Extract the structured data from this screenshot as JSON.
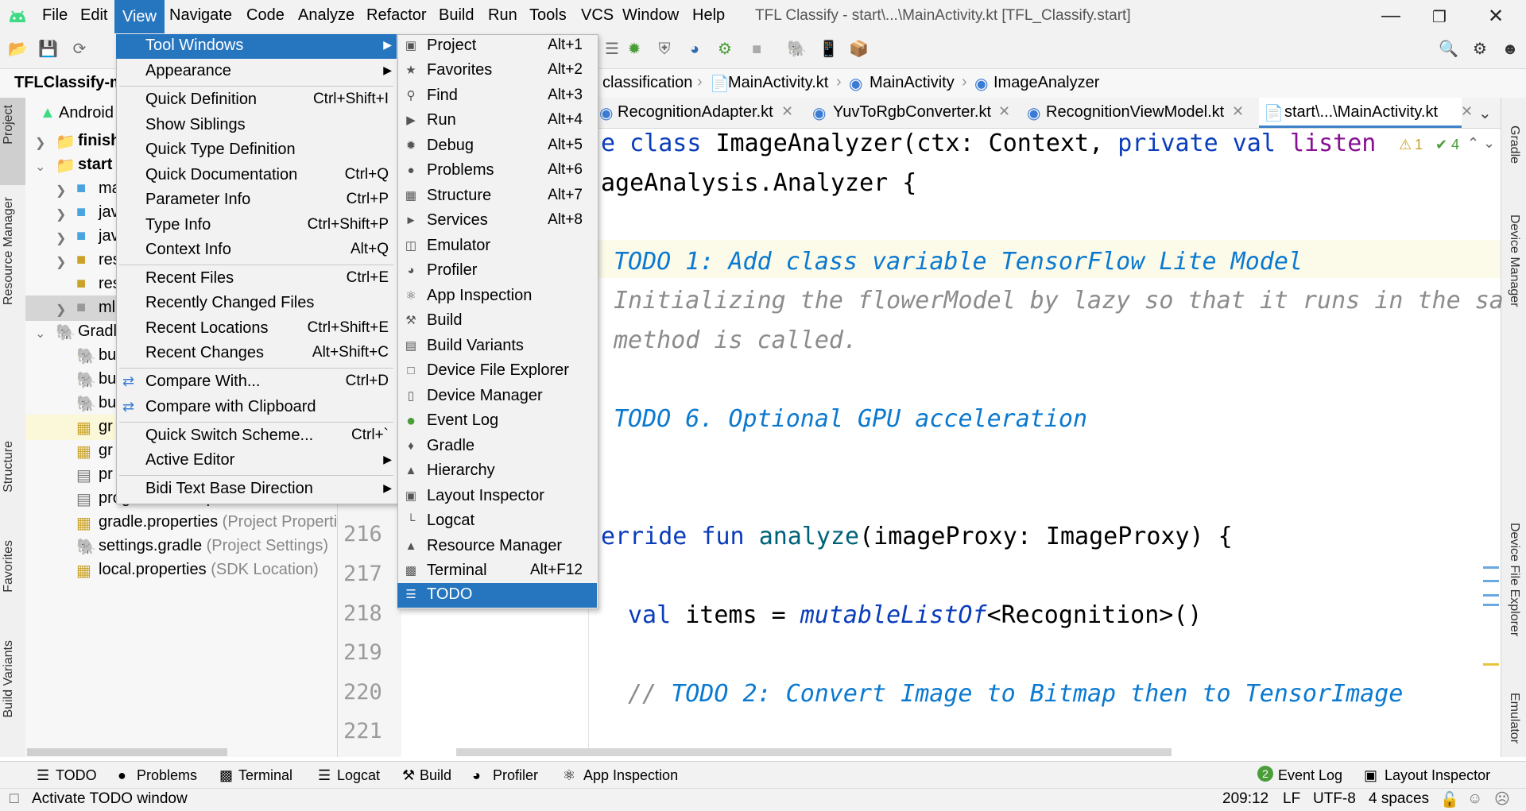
{
  "app": {
    "window_title": "TFL Classify - start\\...\\MainActivity.kt [TFL_Classify.start]"
  },
  "menubar": [
    "File",
    "Edit",
    "View",
    "Navigate",
    "Code",
    "Analyze",
    "Refactor",
    "Build",
    "Run",
    "Tools",
    "VCS",
    "Window",
    "Help"
  ],
  "navbar": {
    "project": "TFLClassify-ma",
    "crumbs": [
      "classification",
      "MainActivity.kt",
      "MainActivity",
      "ImageAnalyzer"
    ]
  },
  "editor_tabs": [
    "RecognitionAdapter.kt",
    "YuvToRgbConverter.kt",
    "RecognitionViewModel.kt",
    "start\\...\\MainActivity.kt"
  ],
  "inspection": {
    "warnings": "1",
    "checks": "4"
  },
  "project_tree": {
    "root": "Android",
    "items": [
      {
        "text": "finish",
        "bold": true
      },
      {
        "text": "start",
        "bold": true
      },
      {
        "text": "ma"
      },
      {
        "text": "jav"
      },
      {
        "text": "jav"
      },
      {
        "text": "res"
      },
      {
        "text": "res"
      },
      {
        "text": "ml"
      },
      {
        "text": "Gradl"
      },
      {
        "text": "bu"
      },
      {
        "text": "bu"
      },
      {
        "text": "bu"
      },
      {
        "text": "gr"
      },
      {
        "text": "gr"
      },
      {
        "text": "pr"
      },
      {
        "text": "proguard-rules.pro"
      },
      {
        "text": "gradle.properties",
        "hint": "(Project Properti"
      },
      {
        "text": "settings.gradle",
        "hint": "(Project Settings)"
      },
      {
        "text": "local.properties",
        "hint": "(SDK Location)"
      }
    ]
  },
  "line_numbers": [
    "216",
    "217",
    "218",
    "219",
    "220",
    "221"
  ],
  "code": {
    "l1_a": "e class ",
    "l1_b": "ImageAnalyzer(ctx: Context, ",
    "l1_c": "private val ",
    "l1_d": "listen",
    "l2": "ageAnalysis.Analyzer {",
    "todo1": "TODO 1: Add class variable TensorFlow Lite Model",
    "cmt1": "Initializing the flowerModel by lazy so that it runs in the sa",
    "cmt2": "method is called.",
    "todo6": "TODO 6. Optional GPU acceleration",
    "l_override_a": "erride fun ",
    "l_override_b": "analyze",
    "l_override_c": "(imageProxy: ImageProxy) {",
    "l_val_a": "val ",
    "l_val_b": "items = ",
    "l_val_c": "mutableListOf",
    "l_val_d": "<Recognition>()",
    "todo2_prefix": "// ",
    "todo2": "TODO 2: Convert Image to Bitmap then to TensorImage"
  },
  "view_menu": {
    "items": [
      {
        "label": "Tool Windows",
        "shortcut": "",
        "submenu": true,
        "selected": true
      },
      {
        "label": "Appearance",
        "shortcut": "",
        "submenu": true
      },
      {
        "label": "Quick Definition",
        "shortcut": "Ctrl+Shift+I"
      },
      {
        "label": "Show Siblings",
        "shortcut": ""
      },
      {
        "label": "Quick Type Definition",
        "shortcut": ""
      },
      {
        "label": "Quick Documentation",
        "shortcut": "Ctrl+Q"
      },
      {
        "label": "Parameter Info",
        "shortcut": "Ctrl+P"
      },
      {
        "label": "Type Info",
        "shortcut": "Ctrl+Shift+P"
      },
      {
        "label": "Context Info",
        "shortcut": "Alt+Q"
      },
      {
        "label": "Recent Files",
        "shortcut": "Ctrl+E"
      },
      {
        "label": "Recently Changed Files",
        "shortcut": ""
      },
      {
        "label": "Recent Locations",
        "shortcut": "Ctrl+Shift+E"
      },
      {
        "label": "Recent Changes",
        "shortcut": "Alt+Shift+C"
      },
      {
        "label": "Compare With...",
        "shortcut": "Ctrl+D"
      },
      {
        "label": "Compare with Clipboard",
        "shortcut": ""
      },
      {
        "label": "Quick Switch Scheme...",
        "shortcut": "Ctrl+`"
      },
      {
        "label": "Active Editor",
        "shortcut": "",
        "submenu": true
      },
      {
        "label": "Bidi Text Base Direction",
        "shortcut": "",
        "submenu": true
      }
    ]
  },
  "tool_windows_menu": {
    "items": [
      {
        "label": "Project",
        "shortcut": "Alt+1",
        "icon": "folder-icon"
      },
      {
        "label": "Favorites",
        "shortcut": "Alt+2",
        "icon": "star-icon"
      },
      {
        "label": "Find",
        "shortcut": "Alt+3",
        "icon": "search-icon"
      },
      {
        "label": "Run",
        "shortcut": "Alt+4",
        "icon": "play-icon"
      },
      {
        "label": "Debug",
        "shortcut": "Alt+5",
        "icon": "bug-icon"
      },
      {
        "label": "Problems",
        "shortcut": "Alt+6",
        "icon": "warning-icon"
      },
      {
        "label": "Structure",
        "shortcut": "Alt+7",
        "icon": "structure-icon"
      },
      {
        "label": "Services",
        "shortcut": "Alt+8",
        "icon": "services-icon"
      },
      {
        "label": "Emulator",
        "shortcut": "",
        "icon": "emulator-icon"
      },
      {
        "label": "Profiler",
        "shortcut": "",
        "icon": "gauge-icon"
      },
      {
        "label": "App Inspection",
        "shortcut": "",
        "icon": "inspection-icon"
      },
      {
        "label": "Build",
        "shortcut": "",
        "icon": "hammer-icon"
      },
      {
        "label": "Build Variants",
        "shortcut": "",
        "icon": "variants-icon"
      },
      {
        "label": "Device File Explorer",
        "shortcut": "",
        "icon": "file-explorer-icon"
      },
      {
        "label": "Device Manager",
        "shortcut": "",
        "icon": "device-icon"
      },
      {
        "label": "Event Log",
        "shortcut": "",
        "icon": "event-log-icon"
      },
      {
        "label": "Gradle",
        "shortcut": "",
        "icon": "gradle-icon"
      },
      {
        "label": "Hierarchy",
        "shortcut": "",
        "icon": "hierarchy-icon"
      },
      {
        "label": "Layout Inspector",
        "shortcut": "",
        "icon": "layout-inspector-icon"
      },
      {
        "label": "Logcat",
        "shortcut": "",
        "icon": "logcat-icon"
      },
      {
        "label": "Resource Manager",
        "shortcut": "",
        "icon": "resource-icon"
      },
      {
        "label": "Terminal",
        "shortcut": "Alt+F12",
        "icon": "terminal-icon"
      },
      {
        "label": "TODO",
        "shortcut": "",
        "icon": "list-icon",
        "selected": true
      }
    ]
  },
  "left_stripe": [
    "Project",
    "Resource Manager",
    "Structure",
    "Favorites",
    "Build Variants"
  ],
  "right_stripe": [
    "Gradle",
    "Device Manager",
    "Device File Explorer",
    "Emulator"
  ],
  "bottom_tools": [
    "TODO",
    "Problems",
    "Terminal",
    "Logcat",
    "Build",
    "Profiler",
    "App Inspection",
    "Event Log",
    "Layout Inspector"
  ],
  "event_log_badge": "2",
  "status": {
    "message": "Activate TODO window",
    "position": "209:12",
    "line_sep": "LF",
    "encoding": "UTF-8",
    "indent": "4 spaces"
  },
  "colors": {
    "selection": "#2675bf",
    "keyword": "#0a3dba",
    "todo": "#0a79d0"
  }
}
